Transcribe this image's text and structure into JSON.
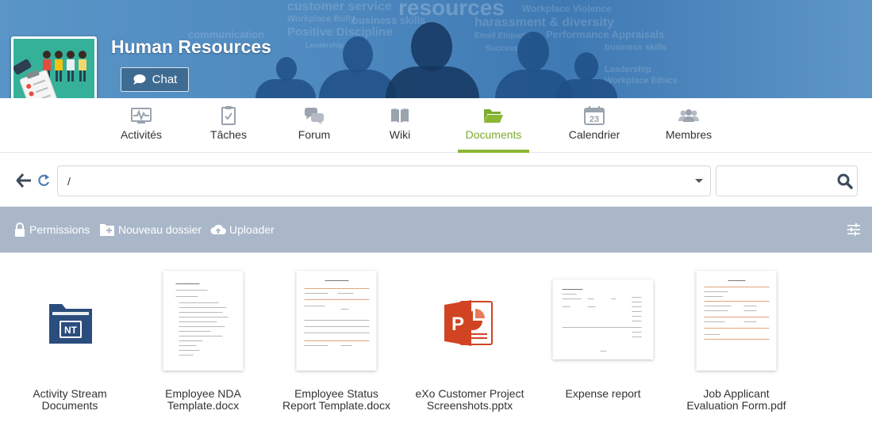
{
  "space": {
    "title": "Human Resources",
    "chat_label": "Chat"
  },
  "banner_words": [
    "customer service",
    "resources",
    "Workplace Violence",
    "Workplace Bully",
    "business skills",
    "harassment & diversity",
    "communication",
    "Positive Discipline",
    "Performance Appraisals",
    "Email Etiquette",
    "Leadership",
    "business skills",
    "Success",
    "Leadership",
    "Workplace Ethics"
  ],
  "tabs": [
    {
      "label": "Activités",
      "icon": "activity-icon"
    },
    {
      "label": "Tâches",
      "icon": "tasks-icon"
    },
    {
      "label": "Forum",
      "icon": "forum-icon"
    },
    {
      "label": "Wiki",
      "icon": "wiki-icon"
    },
    {
      "label": "Documents",
      "icon": "folder-open-icon",
      "active": true
    },
    {
      "label": "Calendrier",
      "icon": "calendar-icon",
      "day": "23"
    },
    {
      "label": "Membres",
      "icon": "members-icon"
    }
  ],
  "path": {
    "value": "/",
    "search_placeholder": ""
  },
  "actions": {
    "permissions": "Permissions",
    "new_folder": "Nouveau dossier",
    "upload": "Uploader"
  },
  "files": [
    {
      "name": "Activity Stream Documents",
      "type": "folder",
      "folder_badge": "NT"
    },
    {
      "name": "Employee NDA Template.docx",
      "type": "docx"
    },
    {
      "name": "Employee Status Report Template.docx",
      "type": "docx"
    },
    {
      "name": "eXo Customer Project Screenshots.pptx",
      "type": "pptx"
    },
    {
      "name": "Expense report",
      "type": "spreadsheet"
    },
    {
      "name": "Job Applicant Evaluation Form.pdf",
      "type": "pdf"
    }
  ],
  "colors": {
    "banner": "#4f8ac0",
    "active_tab": "#8ab734",
    "action_bar": "#a9b7c9",
    "chat_button": "#3e6b91",
    "folder_icon": "#2b4d7e",
    "pptx_icon": "#d04423"
  }
}
